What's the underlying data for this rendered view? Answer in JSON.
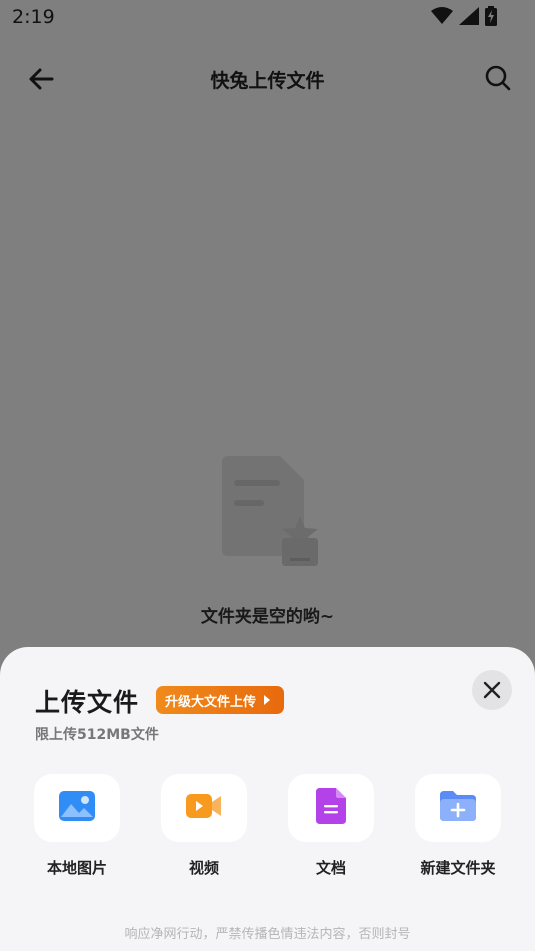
{
  "status_bar": {
    "time": "2:19",
    "icons": [
      "wifi-icon",
      "signal-icon",
      "battery-charging-icon"
    ]
  },
  "header": {
    "title": "快兔上传文件",
    "back_icon": "arrow-left-icon",
    "search_icon": "search-icon"
  },
  "empty_state": {
    "text": "文件夹是空的哟~",
    "icon": "empty-folder-illustration"
  },
  "sheet": {
    "title": "上传文件",
    "upgrade_label": "升级大文件上传",
    "subtitle": "限上传512MB文件",
    "close_icon": "close-icon",
    "options": [
      {
        "label": "本地图片",
        "icon": "image-icon",
        "color": "#2f8df5"
      },
      {
        "label": "视频",
        "icon": "video-icon",
        "color": "#f79a1e"
      },
      {
        "label": "文档",
        "icon": "document-icon",
        "color": "#b342e8"
      },
      {
        "label": "新建文件夹",
        "icon": "new-folder-icon",
        "color": "#5b8cf5"
      }
    ],
    "footer_note": "响应净网行动，严禁传播色情违法内容，否则封号"
  },
  "colors": {
    "accent_orange": "#e86a0d",
    "scrim": "rgba(0,0,0,0.5)",
    "sheet_bg": "#f5f5f7"
  }
}
